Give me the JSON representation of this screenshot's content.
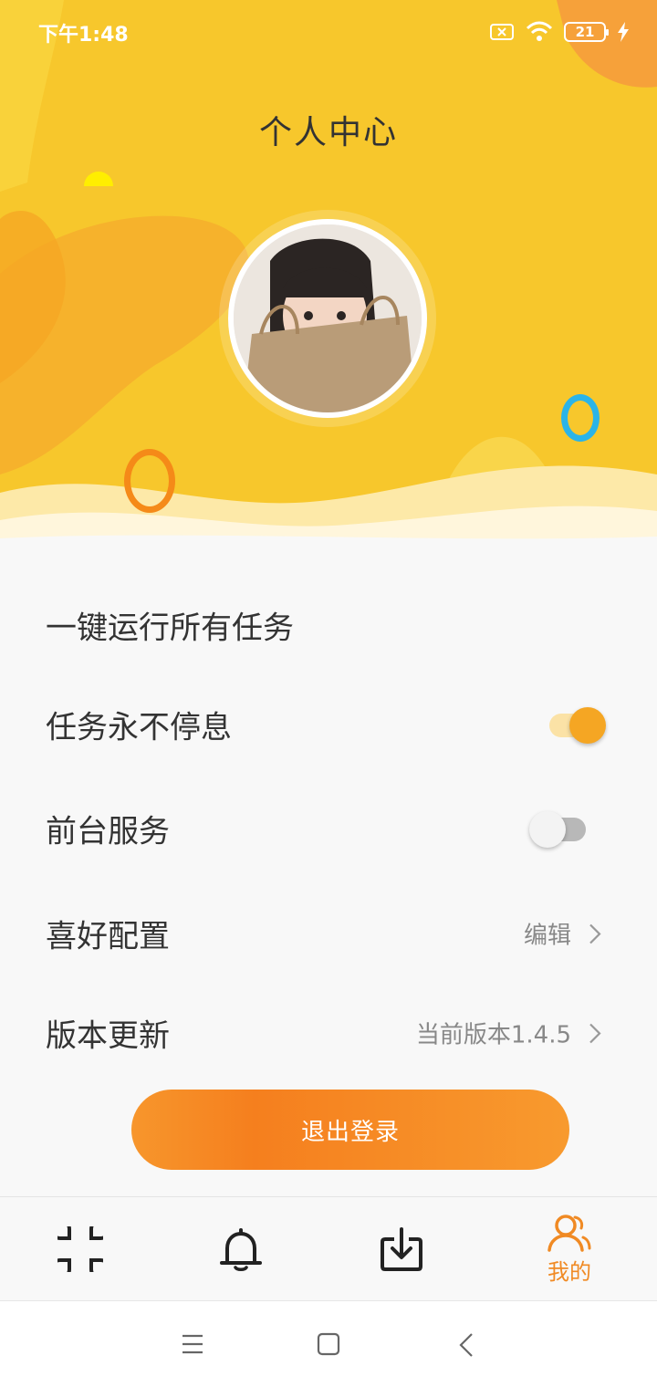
{
  "status_bar": {
    "time": "下午1:48",
    "battery_level": "21",
    "icons": [
      "sim-error-icon",
      "wifi-icon",
      "battery-icon",
      "charging-icon"
    ]
  },
  "header": {
    "title": "个人中心",
    "avatar": "user-avatar"
  },
  "settings": {
    "run_all": {
      "label": "一键运行所有任务"
    },
    "never_rest": {
      "label": "任务永不停息",
      "enabled": true
    },
    "foreground": {
      "label": "前台服务",
      "enabled": false
    },
    "preferences": {
      "label": "喜好配置",
      "value": "编辑"
    },
    "update": {
      "label": "版本更新",
      "value": "当前版本1.4.5"
    }
  },
  "logout_label": "退出登录",
  "bottom_nav": {
    "items": [
      {
        "icon": "grid-icon",
        "label": ""
      },
      {
        "icon": "bell-icon",
        "label": ""
      },
      {
        "icon": "download-icon",
        "label": ""
      },
      {
        "icon": "user-icon",
        "label": "我的",
        "active": true
      }
    ]
  },
  "colors": {
    "header_yellow": "#f7c72c",
    "accent_orange": "#f5a623",
    "button_orange": "#f57f1e",
    "active_tab": "#f08a24"
  }
}
